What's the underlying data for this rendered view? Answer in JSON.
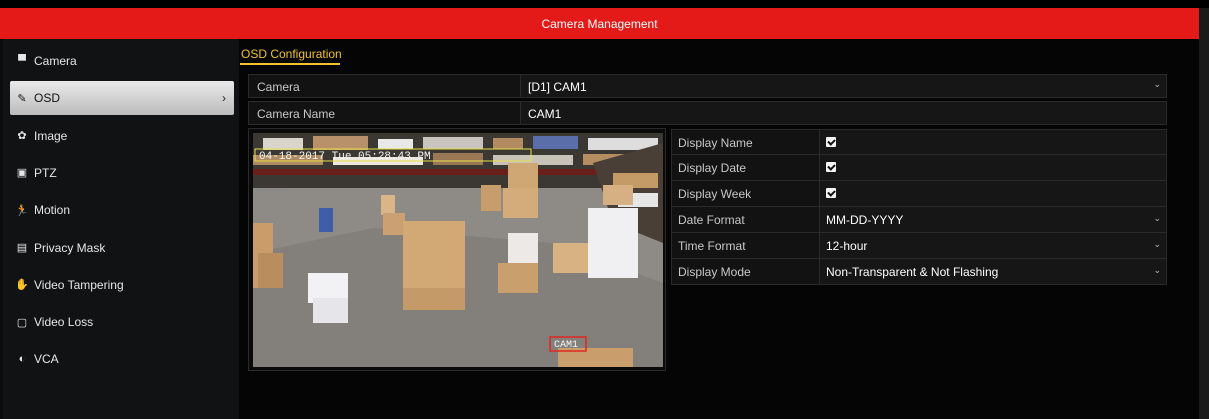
{
  "window": {
    "title": "Camera Management"
  },
  "sidebar": {
    "items": [
      {
        "label": "Camera",
        "icon": "camera-icon",
        "glyph": "▀",
        "active": false
      },
      {
        "label": "OSD",
        "icon": "osd-edit-icon",
        "glyph": "✎",
        "active": true
      },
      {
        "label": "Image",
        "icon": "image-icon",
        "glyph": "✿",
        "active": false
      },
      {
        "label": "PTZ",
        "icon": "ptz-icon",
        "glyph": "▣",
        "active": false
      },
      {
        "label": "Motion",
        "icon": "motion-icon",
        "glyph": "🏃",
        "active": false
      },
      {
        "label": "Privacy Mask",
        "icon": "privacy-mask-icon",
        "glyph": "▤",
        "active": false
      },
      {
        "label": "Video Tampering",
        "icon": "tampering-icon",
        "glyph": "✋",
        "active": false
      },
      {
        "label": "Video Loss",
        "icon": "video-loss-icon",
        "glyph": "▢",
        "active": false
      },
      {
        "label": "VCA",
        "icon": "vca-icon",
        "glyph": "◐",
        "active": false
      }
    ],
    "active_chevron": "›"
  },
  "main": {
    "tab": "OSD Configuration",
    "camera": {
      "label": "Camera",
      "value": "[D1] CAM1"
    },
    "camera_name": {
      "label": "Camera Name",
      "value": "CAM1"
    },
    "options": [
      {
        "label": "Display Name",
        "type": "checkbox",
        "checked": true
      },
      {
        "label": "Display Date",
        "type": "checkbox",
        "checked": true
      },
      {
        "label": "Display Week",
        "type": "checkbox",
        "checked": true
      },
      {
        "label": "Date Format",
        "type": "select",
        "value": "MM-DD-YYYY"
      },
      {
        "label": "Time Format",
        "type": "select",
        "value": "12-hour"
      },
      {
        "label": "Display Mode",
        "type": "select",
        "value": "Non-Transparent & Not Flashing"
      }
    ],
    "preview": {
      "datetime_overlay": "04-18-2017 Tue 05:28:43 PM",
      "name_overlay": "CAM1"
    }
  },
  "colors": {
    "titlebar": "#e31a17",
    "accent": "#f0c232"
  }
}
